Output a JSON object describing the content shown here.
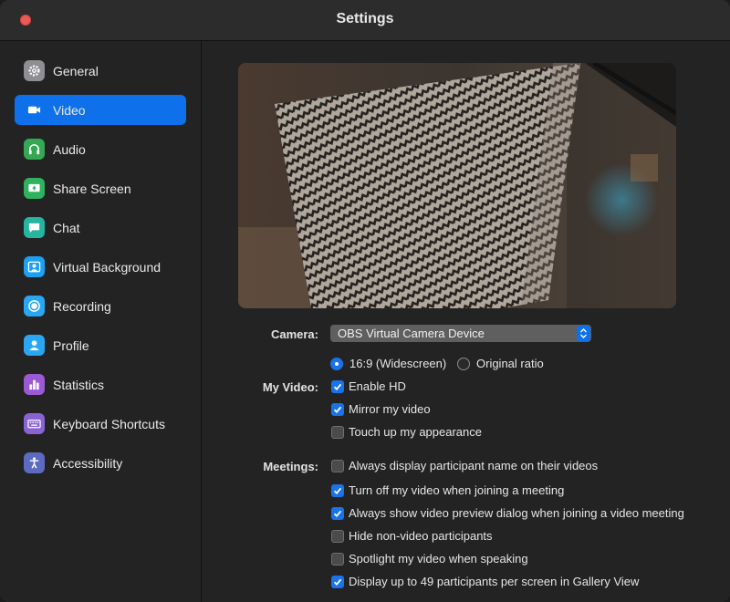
{
  "window": {
    "title": "Settings"
  },
  "sidebar": {
    "items": [
      {
        "label": "General",
        "icon": "gear-icon",
        "color": "#8e8e93",
        "active": false
      },
      {
        "label": "Video",
        "icon": "video-camera-icon",
        "color": "#0e71eb",
        "active": true
      },
      {
        "label": "Audio",
        "icon": "headphones-icon",
        "color": "#34a853",
        "active": false
      },
      {
        "label": "Share Screen",
        "icon": "share-screen-icon",
        "color": "#2eb25e",
        "active": false
      },
      {
        "label": "Chat",
        "icon": "chat-bubble-icon",
        "color": "#25b5a0",
        "active": false
      },
      {
        "label": "Virtual Background",
        "icon": "portrait-icon",
        "color": "#1ea0f0",
        "active": false
      },
      {
        "label": "Recording",
        "icon": "record-icon",
        "color": "#2aa7f2",
        "active": false
      },
      {
        "label": "Profile",
        "icon": "person-icon",
        "color": "#2aa7f2",
        "active": false
      },
      {
        "label": "Statistics",
        "icon": "bar-chart-icon",
        "color": "#9b59d6",
        "active": false
      },
      {
        "label": "Keyboard Shortcuts",
        "icon": "keyboard-icon",
        "color": "#8a63d2",
        "active": false
      },
      {
        "label": "Accessibility",
        "icon": "accessibility-icon",
        "color": "#5c6bc0",
        "active": false
      }
    ]
  },
  "video": {
    "camera_label": "Camera:",
    "camera_value": "OBS Virtual Camera Device",
    "ratio_options": [
      {
        "label": "16:9 (Widescreen)",
        "selected": true
      },
      {
        "label": "Original ratio",
        "selected": false
      }
    ],
    "my_video_label": "My Video:",
    "my_video_options": [
      {
        "label": "Enable HD",
        "checked": true
      },
      {
        "label": "Mirror my video",
        "checked": true
      },
      {
        "label": "Touch up my appearance",
        "checked": false
      }
    ],
    "meetings_label": "Meetings:",
    "meetings_options": [
      {
        "label": "Always display participant name on their videos",
        "checked": false
      },
      {
        "label": "Turn off my video when joining a meeting",
        "checked": true
      },
      {
        "label": "Always show video preview dialog when joining a video meeting",
        "checked": true
      },
      {
        "label": "Hide non-video participants",
        "checked": false
      },
      {
        "label": "Spotlight my video when speaking",
        "checked": false
      },
      {
        "label": "Display up to 49 participants per screen in Gallery View",
        "checked": true
      }
    ]
  },
  "colors": {
    "accent": "#0e71eb",
    "close": "#ed5a55"
  }
}
